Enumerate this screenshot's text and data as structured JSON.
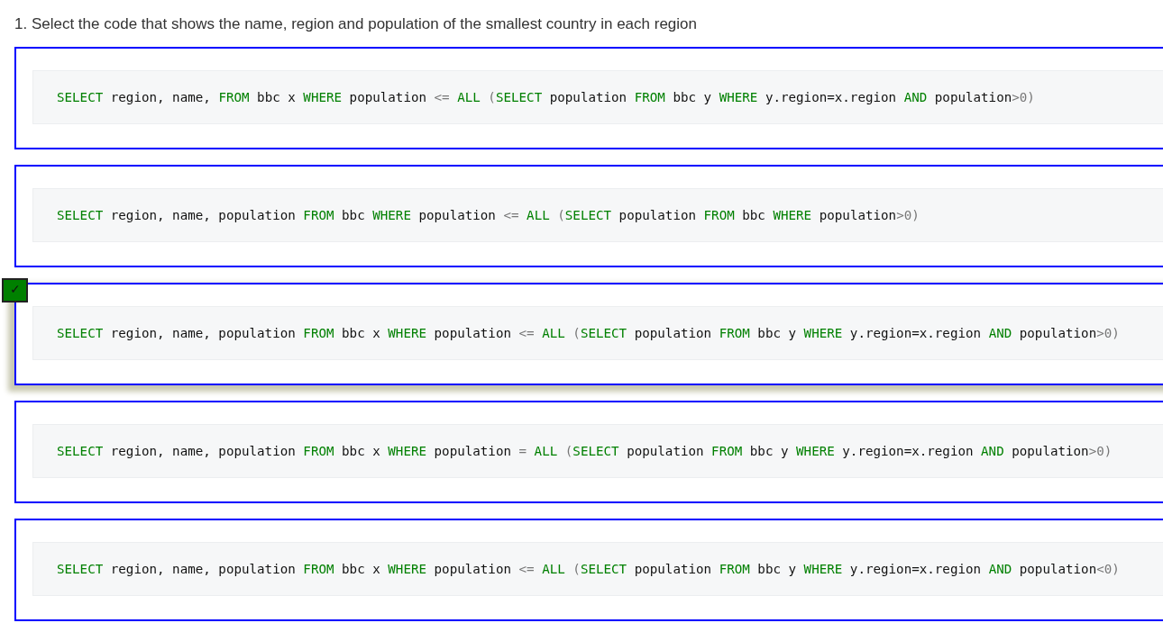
{
  "question": {
    "text": "1. Select the code that shows the name, region and population of the smallest country in each region"
  },
  "check_mark": "✓",
  "options": [
    {
      "selected": false,
      "code": [
        {
          "kind": "keyword",
          "text": "SELECT"
        },
        {
          "kind": "plain",
          "text": " region, name, "
        },
        {
          "kind": "keyword",
          "text": "FROM"
        },
        {
          "kind": "plain",
          "text": " bbc x "
        },
        {
          "kind": "keyword",
          "text": "WHERE"
        },
        {
          "kind": "plain",
          "text": " population "
        },
        {
          "kind": "operator",
          "text": "<="
        },
        {
          "kind": "keyword",
          "text": " ALL"
        },
        {
          "kind": "operator",
          "text": " ("
        },
        {
          "kind": "keyword",
          "text": "SELECT"
        },
        {
          "kind": "plain",
          "text": " population "
        },
        {
          "kind": "keyword",
          "text": "FROM"
        },
        {
          "kind": "plain",
          "text": " bbc y "
        },
        {
          "kind": "keyword",
          "text": "WHERE"
        },
        {
          "kind": "plain",
          "text": " y.region=x.region "
        },
        {
          "kind": "keyword",
          "text": "AND"
        },
        {
          "kind": "plain",
          "text": " population"
        },
        {
          "kind": "operator",
          "text": ">0)"
        }
      ]
    },
    {
      "selected": false,
      "code": [
        {
          "kind": "keyword",
          "text": "SELECT"
        },
        {
          "kind": "plain",
          "text": " region, name, population "
        },
        {
          "kind": "keyword",
          "text": "FROM"
        },
        {
          "kind": "plain",
          "text": " bbc "
        },
        {
          "kind": "keyword",
          "text": "WHERE"
        },
        {
          "kind": "plain",
          "text": " population "
        },
        {
          "kind": "operator",
          "text": "<="
        },
        {
          "kind": "keyword",
          "text": " ALL"
        },
        {
          "kind": "operator",
          "text": " ("
        },
        {
          "kind": "keyword",
          "text": "SELECT"
        },
        {
          "kind": "plain",
          "text": " population "
        },
        {
          "kind": "keyword",
          "text": "FROM"
        },
        {
          "kind": "plain",
          "text": " bbc "
        },
        {
          "kind": "keyword",
          "text": "WHERE"
        },
        {
          "kind": "plain",
          "text": " population"
        },
        {
          "kind": "operator",
          "text": ">0)"
        }
      ]
    },
    {
      "selected": true,
      "code": [
        {
          "kind": "keyword",
          "text": "SELECT"
        },
        {
          "kind": "plain",
          "text": " region, name, population "
        },
        {
          "kind": "keyword",
          "text": "FROM"
        },
        {
          "kind": "plain",
          "text": " bbc x "
        },
        {
          "kind": "keyword",
          "text": "WHERE"
        },
        {
          "kind": "plain",
          "text": " population "
        },
        {
          "kind": "operator",
          "text": "<="
        },
        {
          "kind": "keyword",
          "text": " ALL"
        },
        {
          "kind": "operator",
          "text": " ("
        },
        {
          "kind": "keyword",
          "text": "SELECT"
        },
        {
          "kind": "plain",
          "text": " population "
        },
        {
          "kind": "keyword",
          "text": "FROM"
        },
        {
          "kind": "plain",
          "text": " bbc y "
        },
        {
          "kind": "keyword",
          "text": "WHERE"
        },
        {
          "kind": "plain",
          "text": " y.region=x.region "
        },
        {
          "kind": "keyword",
          "text": "AND"
        },
        {
          "kind": "plain",
          "text": " population"
        },
        {
          "kind": "operator",
          "text": ">0)"
        }
      ]
    },
    {
      "selected": false,
      "code": [
        {
          "kind": "keyword",
          "text": "SELECT"
        },
        {
          "kind": "plain",
          "text": " region, name, population "
        },
        {
          "kind": "keyword",
          "text": "FROM"
        },
        {
          "kind": "plain",
          "text": " bbc x "
        },
        {
          "kind": "keyword",
          "text": "WHERE"
        },
        {
          "kind": "plain",
          "text": " population "
        },
        {
          "kind": "operator",
          "text": "="
        },
        {
          "kind": "keyword",
          "text": " ALL"
        },
        {
          "kind": "operator",
          "text": " ("
        },
        {
          "kind": "keyword",
          "text": "SELECT"
        },
        {
          "kind": "plain",
          "text": " population "
        },
        {
          "kind": "keyword",
          "text": "FROM"
        },
        {
          "kind": "plain",
          "text": " bbc y "
        },
        {
          "kind": "keyword",
          "text": "WHERE"
        },
        {
          "kind": "plain",
          "text": " y.region=x.region "
        },
        {
          "kind": "keyword",
          "text": "AND"
        },
        {
          "kind": "plain",
          "text": " population"
        },
        {
          "kind": "operator",
          "text": ">0)"
        }
      ]
    },
    {
      "selected": false,
      "code": [
        {
          "kind": "keyword",
          "text": "SELECT"
        },
        {
          "kind": "plain",
          "text": " region, name, population "
        },
        {
          "kind": "keyword",
          "text": "FROM"
        },
        {
          "kind": "plain",
          "text": " bbc x "
        },
        {
          "kind": "keyword",
          "text": "WHERE"
        },
        {
          "kind": "plain",
          "text": " population "
        },
        {
          "kind": "operator",
          "text": "<="
        },
        {
          "kind": "keyword",
          "text": " ALL"
        },
        {
          "kind": "operator",
          "text": " ("
        },
        {
          "kind": "keyword",
          "text": "SELECT"
        },
        {
          "kind": "plain",
          "text": " population "
        },
        {
          "kind": "keyword",
          "text": "FROM"
        },
        {
          "kind": "plain",
          "text": " bbc y "
        },
        {
          "kind": "keyword",
          "text": "WHERE"
        },
        {
          "kind": "plain",
          "text": " y.region=x.region "
        },
        {
          "kind": "keyword",
          "text": "AND"
        },
        {
          "kind": "plain",
          "text": " population"
        },
        {
          "kind": "operator",
          "text": "<0)"
        }
      ]
    }
  ]
}
